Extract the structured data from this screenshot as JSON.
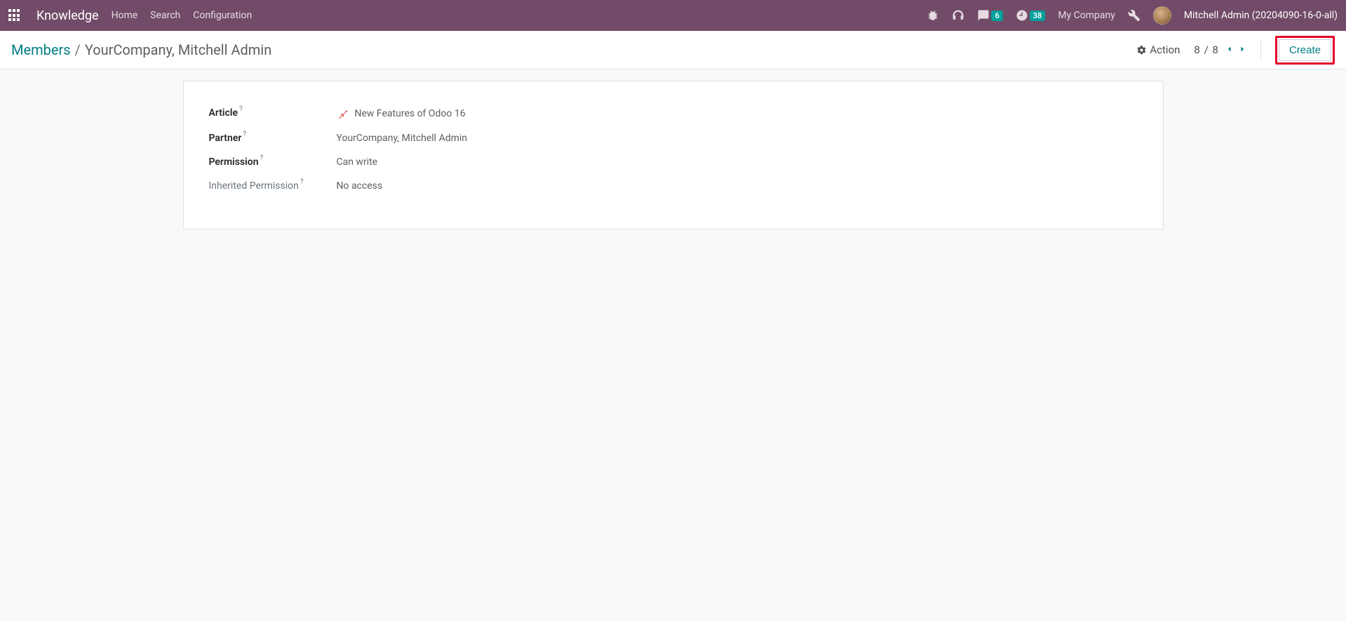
{
  "navbar": {
    "brand": "Knowledge",
    "links": [
      "Home",
      "Search",
      "Configuration"
    ],
    "messages_count": "6",
    "activities_count": "38",
    "company": "My Company",
    "user": "Mitchell Admin (20204090-16-0-all)"
  },
  "control_panel": {
    "breadcrumb_root": "Members",
    "breadcrumb_current": "YourCompany, Mitchell Admin",
    "action_label": "Action",
    "pager_current": "8",
    "pager_total": "8",
    "pager_sep": "/",
    "create_label": "Create"
  },
  "form": {
    "fields": [
      {
        "label": "Article",
        "muted_label": false,
        "has_help": true,
        "icon": "pushpin",
        "value": "New Features of Odoo 16",
        "muted_value": false
      },
      {
        "label": "Partner",
        "muted_label": false,
        "has_help": true,
        "icon": null,
        "value": "YourCompany, Mitchell Admin",
        "muted_value": false
      },
      {
        "label": "Permission",
        "muted_label": false,
        "has_help": true,
        "icon": null,
        "value": "Can write",
        "muted_value": true
      },
      {
        "label": "Inherited Permission",
        "muted_label": true,
        "has_help": true,
        "icon": null,
        "value": "No access",
        "muted_value": false
      }
    ]
  }
}
